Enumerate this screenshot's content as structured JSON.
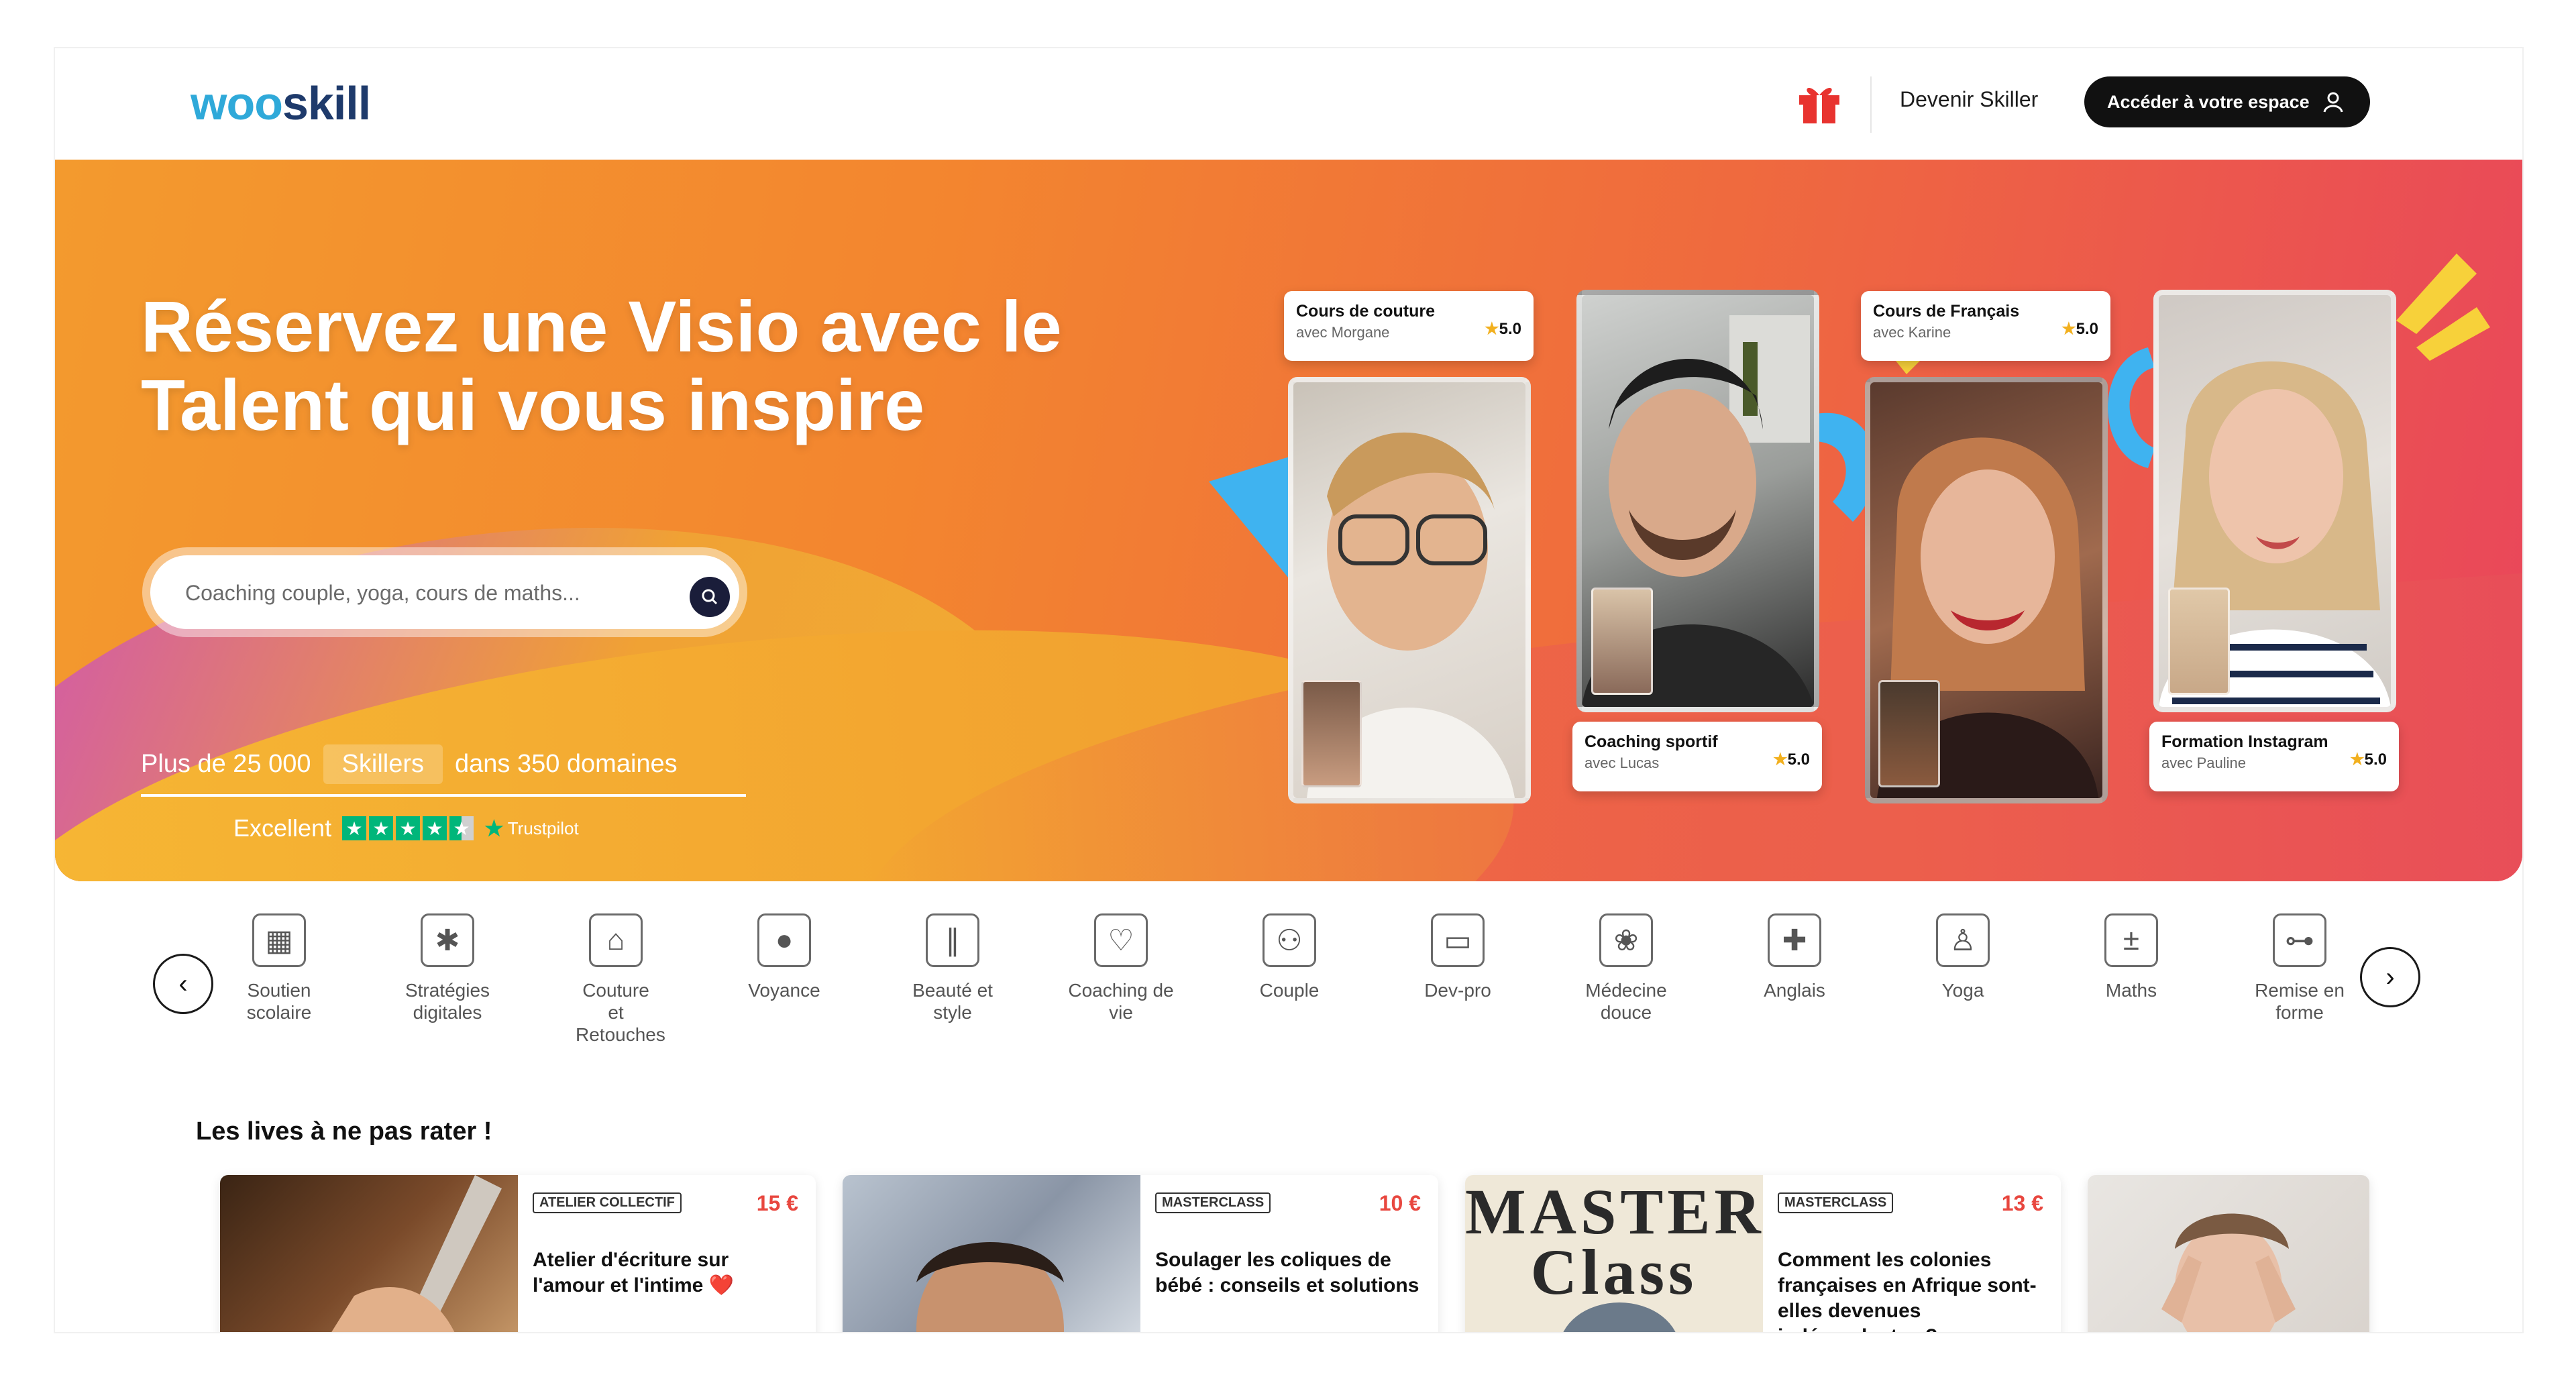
{
  "header": {
    "logo_part1": "woo",
    "logo_part2": "skill",
    "gift_icon": "gift-icon",
    "devenir_label": "Devenir Skiller",
    "access_label": "Accéder à votre espace"
  },
  "hero": {
    "title_line1": "Réservez une Visio avec le",
    "title_line2": "Talent qui vous inspire",
    "search_placeholder": "Coaching couple, yoga, cours de maths...",
    "stats_prefix": "Plus de 25 000",
    "stats_pill": "Skillers",
    "stats_suffix": "dans 350 domaines",
    "rating_label": "Excellent",
    "trustpilot_label": "Trustpilot",
    "rating_stars": 4.5,
    "cards": [
      {
        "title": "Cours de couture",
        "subtitle": "avec Morgane",
        "rating": "5.0"
      },
      {
        "title": "Coaching sportif",
        "subtitle": "avec Lucas",
        "rating": "5.0"
      },
      {
        "title": "Cours de Français",
        "subtitle": "avec Karine",
        "rating": "5.0"
      },
      {
        "title": "Formation Instagram",
        "subtitle": "avec Pauline",
        "rating": "5.0"
      }
    ]
  },
  "categories": [
    {
      "label": "Soutien scolaire",
      "icon": "book-icon",
      "glyph": "▦"
    },
    {
      "label": "Stratégies digitales",
      "icon": "network-icon",
      "glyph": "✱"
    },
    {
      "label": "Couture et Retouches",
      "icon": "sewing-machine-icon",
      "glyph": "⌂"
    },
    {
      "label": "Voyance",
      "icon": "crystal-ball-icon",
      "glyph": "●"
    },
    {
      "label": "Beauté et style",
      "icon": "makeup-brush-icon",
      "glyph": "∥"
    },
    {
      "label": "Coaching de vie",
      "icon": "handshake-icon",
      "glyph": "♡"
    },
    {
      "label": "Couple",
      "icon": "couple-icon",
      "glyph": "⚇"
    },
    {
      "label": "Dev-pro",
      "icon": "laptop-icon",
      "glyph": "▭"
    },
    {
      "label": "Médecine douce",
      "icon": "lotus-icon",
      "glyph": "❀"
    },
    {
      "label": "Anglais",
      "icon": "uk-flag-icon",
      "glyph": "✚"
    },
    {
      "label": "Yoga",
      "icon": "yoga-icon",
      "glyph": "♙"
    },
    {
      "label": "Maths",
      "icon": "calculator-icon",
      "glyph": "±"
    },
    {
      "label": "Remise en forme",
      "icon": "dumbbell-icon",
      "glyph": "⊶"
    }
  ],
  "section_title": "Les lives à ne pas rater !",
  "lives": [
    {
      "badge": "ATELIER COLLECTIF",
      "price": "15 €",
      "title": "Atelier d'écriture sur l'amour et l'intime ❤️"
    },
    {
      "badge": "MASTERCLASS",
      "price": "10 €",
      "title": "Soulager les coliques de bébé : conseils et solutions"
    },
    {
      "badge": "MASTERCLASS",
      "price": "13 €",
      "title": "Comment les colonies françaises en Afrique sont-elles devenues indépendantes ?",
      "image_text": "MASTER Class"
    }
  ],
  "colors": {
    "accent": "#ef6a3e",
    "trustpilot": "#00b67a",
    "price": "#e8473f"
  }
}
